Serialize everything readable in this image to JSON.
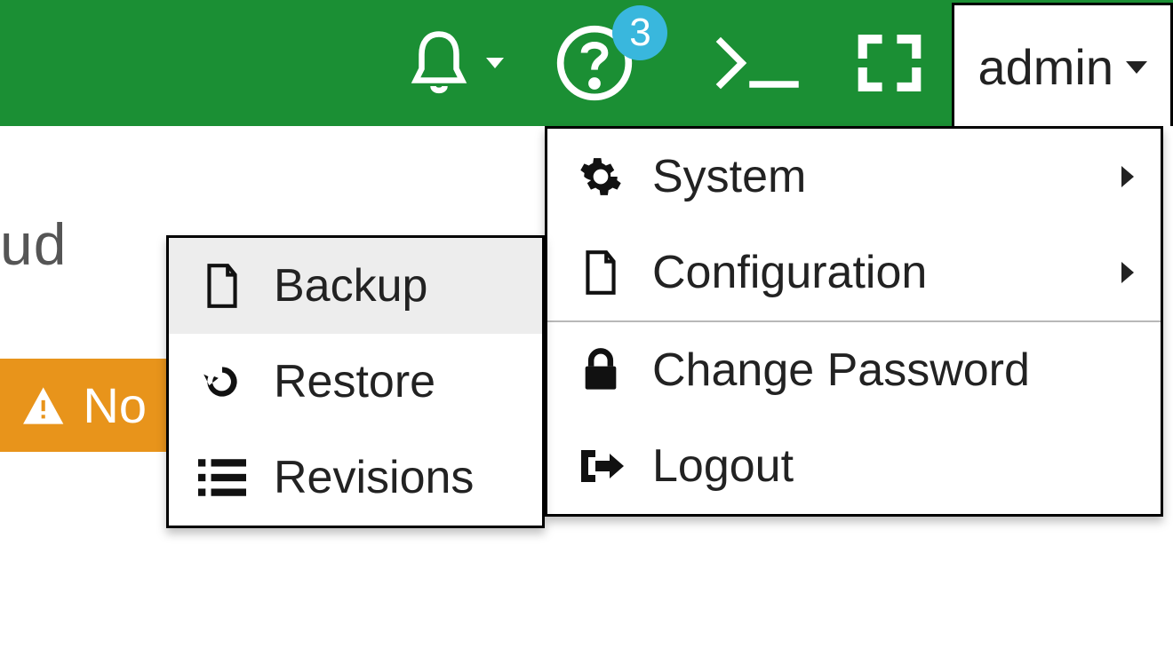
{
  "topbar": {
    "notifications_badge": "3",
    "user_label": "admin"
  },
  "user_menu": {
    "items": [
      {
        "label": "System",
        "has_submenu": true
      },
      {
        "label": "Configuration",
        "has_submenu": true
      },
      {
        "label": "Change Password",
        "has_submenu": false
      },
      {
        "label": "Logout",
        "has_submenu": false
      }
    ]
  },
  "config_submenu": {
    "items": [
      {
        "label": "Backup"
      },
      {
        "label": "Restore"
      },
      {
        "label": "Revisions"
      }
    ]
  },
  "page": {
    "partial_title": "ud"
  },
  "banner": {
    "partial_text": "No"
  }
}
